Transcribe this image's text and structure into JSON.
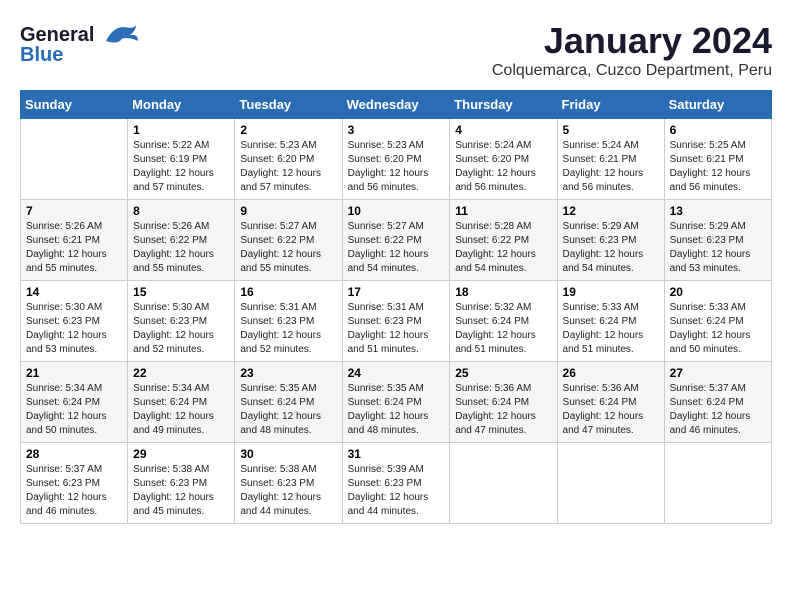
{
  "logo": {
    "general": "General",
    "blue": "Blue"
  },
  "title": "January 2024",
  "subtitle": "Colquemarca, Cuzco Department, Peru",
  "days_of_week": [
    "Sunday",
    "Monday",
    "Tuesday",
    "Wednesday",
    "Thursday",
    "Friday",
    "Saturday"
  ],
  "weeks": [
    [
      {
        "day": "",
        "sunrise": "",
        "sunset": "",
        "daylight": ""
      },
      {
        "day": "1",
        "sunrise": "Sunrise: 5:22 AM",
        "sunset": "Sunset: 6:19 PM",
        "daylight": "Daylight: 12 hours and 57 minutes."
      },
      {
        "day": "2",
        "sunrise": "Sunrise: 5:23 AM",
        "sunset": "Sunset: 6:20 PM",
        "daylight": "Daylight: 12 hours and 57 minutes."
      },
      {
        "day": "3",
        "sunrise": "Sunrise: 5:23 AM",
        "sunset": "Sunset: 6:20 PM",
        "daylight": "Daylight: 12 hours and 56 minutes."
      },
      {
        "day": "4",
        "sunrise": "Sunrise: 5:24 AM",
        "sunset": "Sunset: 6:20 PM",
        "daylight": "Daylight: 12 hours and 56 minutes."
      },
      {
        "day": "5",
        "sunrise": "Sunrise: 5:24 AM",
        "sunset": "Sunset: 6:21 PM",
        "daylight": "Daylight: 12 hours and 56 minutes."
      },
      {
        "day": "6",
        "sunrise": "Sunrise: 5:25 AM",
        "sunset": "Sunset: 6:21 PM",
        "daylight": "Daylight: 12 hours and 56 minutes."
      }
    ],
    [
      {
        "day": "7",
        "sunrise": "Sunrise: 5:26 AM",
        "sunset": "Sunset: 6:21 PM",
        "daylight": "Daylight: 12 hours and 55 minutes."
      },
      {
        "day": "8",
        "sunrise": "Sunrise: 5:26 AM",
        "sunset": "Sunset: 6:22 PM",
        "daylight": "Daylight: 12 hours and 55 minutes."
      },
      {
        "day": "9",
        "sunrise": "Sunrise: 5:27 AM",
        "sunset": "Sunset: 6:22 PM",
        "daylight": "Daylight: 12 hours and 55 minutes."
      },
      {
        "day": "10",
        "sunrise": "Sunrise: 5:27 AM",
        "sunset": "Sunset: 6:22 PM",
        "daylight": "Daylight: 12 hours and 54 minutes."
      },
      {
        "day": "11",
        "sunrise": "Sunrise: 5:28 AM",
        "sunset": "Sunset: 6:22 PM",
        "daylight": "Daylight: 12 hours and 54 minutes."
      },
      {
        "day": "12",
        "sunrise": "Sunrise: 5:29 AM",
        "sunset": "Sunset: 6:23 PM",
        "daylight": "Daylight: 12 hours and 54 minutes."
      },
      {
        "day": "13",
        "sunrise": "Sunrise: 5:29 AM",
        "sunset": "Sunset: 6:23 PM",
        "daylight": "Daylight: 12 hours and 53 minutes."
      }
    ],
    [
      {
        "day": "14",
        "sunrise": "Sunrise: 5:30 AM",
        "sunset": "Sunset: 6:23 PM",
        "daylight": "Daylight: 12 hours and 53 minutes."
      },
      {
        "day": "15",
        "sunrise": "Sunrise: 5:30 AM",
        "sunset": "Sunset: 6:23 PM",
        "daylight": "Daylight: 12 hours and 52 minutes."
      },
      {
        "day": "16",
        "sunrise": "Sunrise: 5:31 AM",
        "sunset": "Sunset: 6:23 PM",
        "daylight": "Daylight: 12 hours and 52 minutes."
      },
      {
        "day": "17",
        "sunrise": "Sunrise: 5:31 AM",
        "sunset": "Sunset: 6:23 PM",
        "daylight": "Daylight: 12 hours and 51 minutes."
      },
      {
        "day": "18",
        "sunrise": "Sunrise: 5:32 AM",
        "sunset": "Sunset: 6:24 PM",
        "daylight": "Daylight: 12 hours and 51 minutes."
      },
      {
        "day": "19",
        "sunrise": "Sunrise: 5:33 AM",
        "sunset": "Sunset: 6:24 PM",
        "daylight": "Daylight: 12 hours and 51 minutes."
      },
      {
        "day": "20",
        "sunrise": "Sunrise: 5:33 AM",
        "sunset": "Sunset: 6:24 PM",
        "daylight": "Daylight: 12 hours and 50 minutes."
      }
    ],
    [
      {
        "day": "21",
        "sunrise": "Sunrise: 5:34 AM",
        "sunset": "Sunset: 6:24 PM",
        "daylight": "Daylight: 12 hours and 50 minutes."
      },
      {
        "day": "22",
        "sunrise": "Sunrise: 5:34 AM",
        "sunset": "Sunset: 6:24 PM",
        "daylight": "Daylight: 12 hours and 49 minutes."
      },
      {
        "day": "23",
        "sunrise": "Sunrise: 5:35 AM",
        "sunset": "Sunset: 6:24 PM",
        "daylight": "Daylight: 12 hours and 48 minutes."
      },
      {
        "day": "24",
        "sunrise": "Sunrise: 5:35 AM",
        "sunset": "Sunset: 6:24 PM",
        "daylight": "Daylight: 12 hours and 48 minutes."
      },
      {
        "day": "25",
        "sunrise": "Sunrise: 5:36 AM",
        "sunset": "Sunset: 6:24 PM",
        "daylight": "Daylight: 12 hours and 47 minutes."
      },
      {
        "day": "26",
        "sunrise": "Sunrise: 5:36 AM",
        "sunset": "Sunset: 6:24 PM",
        "daylight": "Daylight: 12 hours and 47 minutes."
      },
      {
        "day": "27",
        "sunrise": "Sunrise: 5:37 AM",
        "sunset": "Sunset: 6:24 PM",
        "daylight": "Daylight: 12 hours and 46 minutes."
      }
    ],
    [
      {
        "day": "28",
        "sunrise": "Sunrise: 5:37 AM",
        "sunset": "Sunset: 6:23 PM",
        "daylight": "Daylight: 12 hours and 46 minutes."
      },
      {
        "day": "29",
        "sunrise": "Sunrise: 5:38 AM",
        "sunset": "Sunset: 6:23 PM",
        "daylight": "Daylight: 12 hours and 45 minutes."
      },
      {
        "day": "30",
        "sunrise": "Sunrise: 5:38 AM",
        "sunset": "Sunset: 6:23 PM",
        "daylight": "Daylight: 12 hours and 44 minutes."
      },
      {
        "day": "31",
        "sunrise": "Sunrise: 5:39 AM",
        "sunset": "Sunset: 6:23 PM",
        "daylight": "Daylight: 12 hours and 44 minutes."
      },
      {
        "day": "",
        "sunrise": "",
        "sunset": "",
        "daylight": ""
      },
      {
        "day": "",
        "sunrise": "",
        "sunset": "",
        "daylight": ""
      },
      {
        "day": "",
        "sunrise": "",
        "sunset": "",
        "daylight": ""
      }
    ]
  ]
}
